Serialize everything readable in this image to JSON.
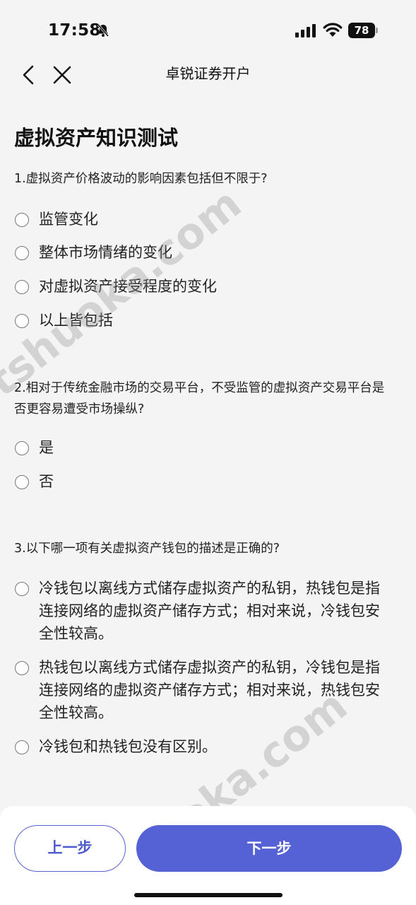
{
  "status_bar": {
    "time": "17:58",
    "battery": "78",
    "icons": [
      "bell-slash-icon",
      "cellular-signal-icon",
      "wifi-icon",
      "battery-icon"
    ]
  },
  "nav": {
    "title": "卓锐证券开户",
    "back_icon": "chevron-left-icon",
    "close_icon": "close-icon"
  },
  "page_title": "虚拟资产知识测试",
  "questions": [
    {
      "text": "1.虚拟资产价格波动的影响因素包括但不限于?",
      "options": [
        "监管变化",
        "整体市场情绪的变化",
        "对虚拟资产接受程度的变化",
        "以上皆包括"
      ]
    },
    {
      "text": "2.相对于传统金融市场的交易平台，不受监管的虚拟资产交易平台是否更容易遭受市场操纵?",
      "options": [
        "是",
        "否"
      ]
    },
    {
      "text": "3.以下哪一项有关虚拟资产钱包的描述是正确的?",
      "options": [
        "冷钱包以离线方式储存虚拟资产的私钥，热钱包是指连接网络的虚拟资产储存方式；相对来说，冷钱包安全性较高。",
        "热钱包以离线方式储存虚拟资产的私钥，冷钱包是指连接网络的虚拟资产储存方式；相对来说，热钱包安全性较高。",
        "冷钱包和热钱包没有区别。"
      ]
    }
  ],
  "footer": {
    "prev_label": "上一步",
    "next_label": "下一步"
  },
  "watermark": "tshuoka.com",
  "colors": {
    "accent": "#5562d6",
    "background": "#f4f4f4"
  }
}
